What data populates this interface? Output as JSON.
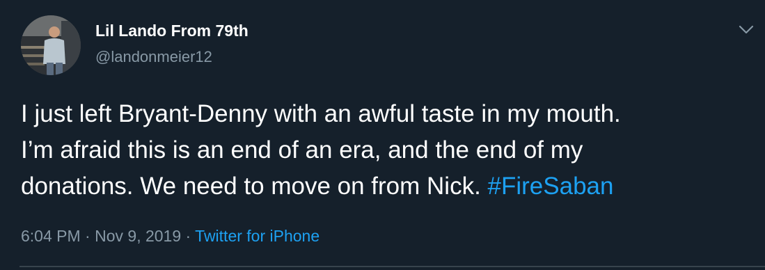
{
  "user": {
    "display_name": "Lil Lando From 79th",
    "handle": "@landonmeier12"
  },
  "tweet": {
    "line1": "I just left Bryant-Denny with an awful taste in my mouth.",
    "line2": "I’m afraid this is an end of an era, and the end of my",
    "line3_text": "donations. We need to move on from Nick. ",
    "hashtag": "#FireSaban"
  },
  "meta": {
    "time": "6:04 PM",
    "sep1": " · ",
    "date": "Nov 9, 2019",
    "sep2": " · ",
    "source": "Twitter for iPhone"
  },
  "icons": {
    "menu": "chevron-down-icon"
  },
  "colors": {
    "background": "#15202b",
    "text": "#ffffff",
    "secondary": "#8899a6",
    "accent": "#1da1f2",
    "divider": "#38444d"
  }
}
